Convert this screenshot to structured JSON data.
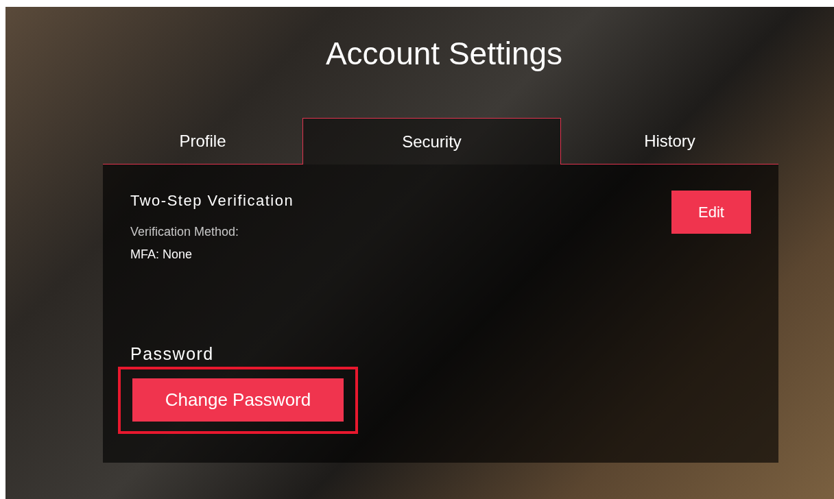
{
  "title": "Account Settings",
  "tabs": [
    {
      "label": "Profile",
      "selected": false
    },
    {
      "label": "Security",
      "selected": true
    },
    {
      "label": "History",
      "selected": false
    }
  ],
  "two_step": {
    "heading": "Two-Step Verification",
    "method_label": "Verification Method:",
    "method_value": "MFA: None",
    "button": "Edit"
  },
  "password": {
    "heading": "Password",
    "button": "Change Password",
    "highlighted": true
  }
}
